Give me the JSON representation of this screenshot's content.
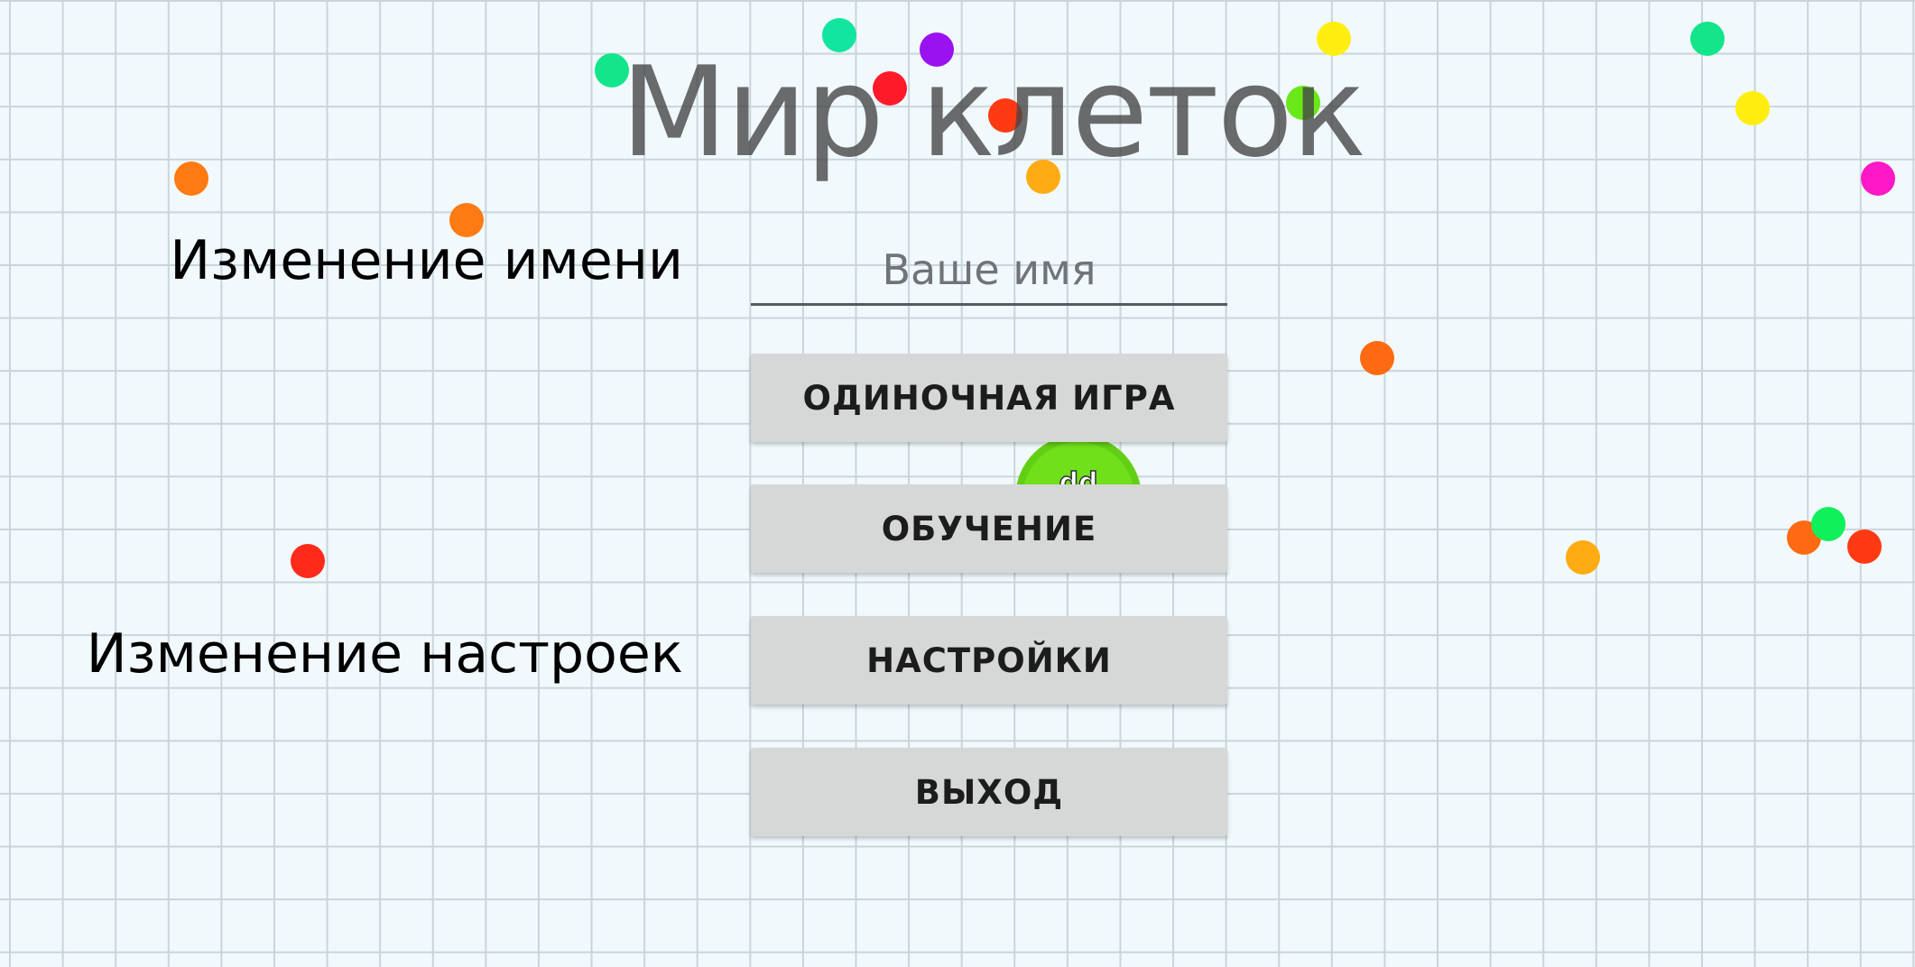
{
  "app": {
    "title": "Мир клеток"
  },
  "labels": {
    "change_name": "Изменение имени",
    "change_settings": "Изменение настроек"
  },
  "name_input": {
    "placeholder": "Ваше имя",
    "value": ""
  },
  "menu": {
    "buttons": [
      {
        "label": "ОДИНОЧНАЯ ИГРА"
      },
      {
        "label": "ОБУЧЕНИЕ"
      },
      {
        "label": "НАСТРОЙКИ"
      },
      {
        "label": "ВЫХОД"
      }
    ]
  },
  "player_cell": {
    "name": "dd",
    "color": "#6fe01a"
  },
  "colors": {
    "background": "#f1f9fd",
    "grid": "#c9d5da",
    "button": "#d6d7d7",
    "food": [
      "#12e58a",
      "#ff2a1a",
      "#9a12f0",
      "#ffee10",
      "#6be81a",
      "#ff7a12",
      "#ffab14",
      "#ff18c8",
      "#0ff05a"
    ]
  }
}
